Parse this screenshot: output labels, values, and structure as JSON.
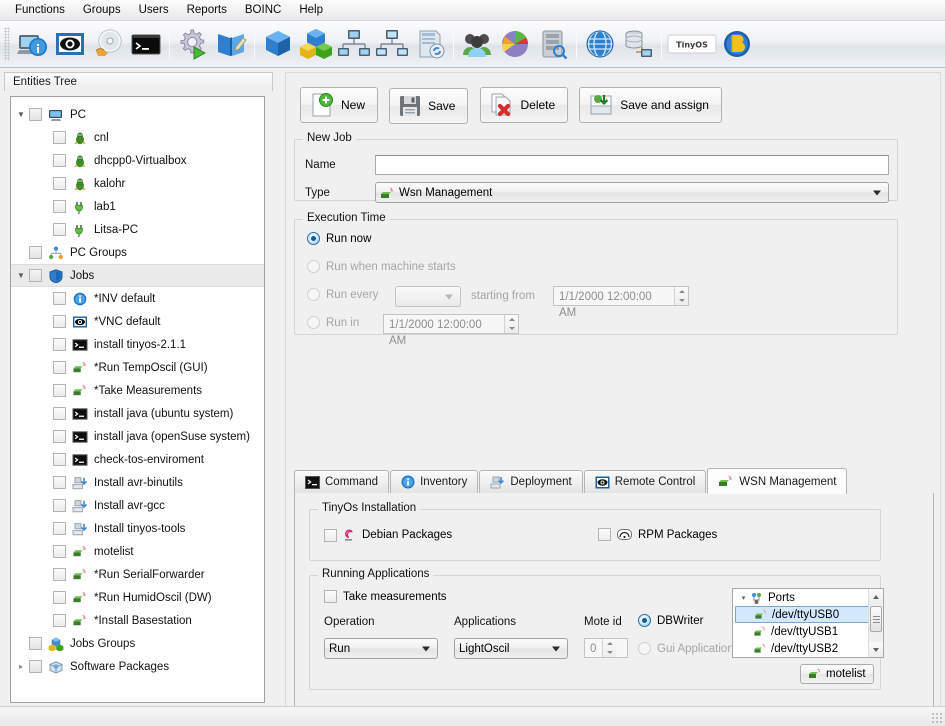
{
  "menu": {
    "items": [
      {
        "label": "Functions",
        "name": "menu-functions"
      },
      {
        "label": "Groups",
        "name": "menu-groups"
      },
      {
        "label": "Users",
        "name": "menu-users"
      },
      {
        "label": "Reports",
        "name": "menu-reports"
      },
      {
        "label": "BOINC",
        "name": "menu-boinc"
      },
      {
        "label": "Help",
        "name": "menu-help"
      }
    ]
  },
  "toolbar": {
    "buttons": [
      {
        "icon": "computer-info-icon",
        "group": 1
      },
      {
        "icon": "eye-monitor-icon",
        "group": 1
      },
      {
        "icon": "disc-hand-icon",
        "group": 1
      },
      {
        "icon": "terminal-console-icon",
        "group": 1
      },
      {
        "icon": "gear-play-icon",
        "group": 2
      },
      {
        "icon": "blue-book-pencil-icon",
        "group": 2
      },
      {
        "icon": "blue-cube-icon",
        "group": 3
      },
      {
        "icon": "cube-group-icon",
        "group": 3
      },
      {
        "icon": "network-computers-icon",
        "group": 3
      },
      {
        "icon": "network-computers-alt-icon",
        "group": 3
      },
      {
        "icon": "book-refresh-icon",
        "group": 3
      },
      {
        "icon": "users-group-icon",
        "group": 4
      },
      {
        "icon": "pie-chart-icon",
        "group": 4
      },
      {
        "icon": "server-search-icon",
        "group": 4
      },
      {
        "icon": "globe-icon",
        "group": 5
      },
      {
        "icon": "database-network-icon",
        "group": 5
      },
      {
        "icon": "tinyos-logo-icon",
        "group": 6
      },
      {
        "icon": "boinc-logo-icon",
        "group": 6
      }
    ]
  },
  "left_pane": {
    "header": "Entities Tree",
    "tree": [
      {
        "label": "PC",
        "level": 1,
        "icon": "monitor-icon",
        "expander": "expanded",
        "checkbox": true,
        "selected": false
      },
      {
        "label": "cnl",
        "level": 2,
        "icon": "linux-tux-icon",
        "expander": "none",
        "checkbox": true,
        "selected": false
      },
      {
        "label": "dhcpp0-Virtualbox",
        "level": 2,
        "icon": "linux-tux-icon",
        "expander": "none",
        "checkbox": true,
        "selected": false
      },
      {
        "label": "kalohr",
        "level": 2,
        "icon": "linux-tux-icon",
        "expander": "none",
        "checkbox": true,
        "selected": false
      },
      {
        "label": "lab1",
        "level": 2,
        "icon": "plug-green-icon",
        "expander": "none",
        "checkbox": true,
        "selected": false
      },
      {
        "label": "Litsa-PC",
        "level": 2,
        "icon": "plug-green-icon",
        "expander": "none",
        "checkbox": true,
        "selected": false
      },
      {
        "label": "PC Groups",
        "level": 1,
        "icon": "network-tree-icon",
        "expander": "none",
        "checkbox": true,
        "selected": false
      },
      {
        "label": "Jobs",
        "level": 1,
        "icon": "shield-blue-icon",
        "expander": "expanded",
        "checkbox": true,
        "selected": true
      },
      {
        "label": "*INV default",
        "level": 2,
        "icon": "info-blue-icon",
        "expander": "none",
        "checkbox": true,
        "selected": false
      },
      {
        "label": "*VNC default",
        "level": 2,
        "icon": "vnc-eye-icon",
        "expander": "none",
        "checkbox": true,
        "selected": false
      },
      {
        "label": "install tinyos-2.1.1",
        "level": 2,
        "icon": "terminal-icon",
        "expander": "none",
        "checkbox": true,
        "selected": false
      },
      {
        "label": "*Run TempOscil (GUI)",
        "level": 2,
        "icon": "mote-sensor-icon",
        "expander": "none",
        "checkbox": true,
        "selected": false
      },
      {
        "label": "*Take Measurements",
        "level": 2,
        "icon": "mote-sensor-icon",
        "expander": "none",
        "checkbox": true,
        "selected": false
      },
      {
        "label": "install java (ubuntu system)",
        "level": 2,
        "icon": "terminal-icon",
        "expander": "none",
        "checkbox": true,
        "selected": false
      },
      {
        "label": "install java (openSuse system)",
        "level": 2,
        "icon": "terminal-icon",
        "expander": "none",
        "checkbox": true,
        "selected": false
      },
      {
        "label": "check-tos-enviroment",
        "level": 2,
        "icon": "terminal-icon",
        "expander": "none",
        "checkbox": true,
        "selected": false
      },
      {
        "label": "Install avr-binutils",
        "level": 2,
        "icon": "package-install-icon",
        "expander": "none",
        "checkbox": true,
        "selected": false
      },
      {
        "label": "Install avr-gcc",
        "level": 2,
        "icon": "package-install-icon",
        "expander": "none",
        "checkbox": true,
        "selected": false
      },
      {
        "label": "Install tinyos-tools",
        "level": 2,
        "icon": "package-install-icon",
        "expander": "none",
        "checkbox": true,
        "selected": false
      },
      {
        "label": "motelist",
        "level": 2,
        "icon": "mote-sensor-icon",
        "expander": "none",
        "checkbox": true,
        "selected": false
      },
      {
        "label": "*Run SerialForwarder",
        "level": 2,
        "icon": "mote-sensor-icon",
        "expander": "none",
        "checkbox": true,
        "selected": false
      },
      {
        "label": "*Run HumidOscil (DW)",
        "level": 2,
        "icon": "mote-sensor-icon",
        "expander": "none",
        "checkbox": true,
        "selected": false
      },
      {
        "label": "*Install Basestation",
        "level": 2,
        "icon": "mote-sensor-icon",
        "expander": "none",
        "checkbox": true,
        "selected": false
      },
      {
        "label": "Jobs Groups",
        "level": 1,
        "icon": "cube-group-icon",
        "expander": "none",
        "checkbox": true,
        "selected": false
      },
      {
        "label": "Software Packages",
        "level": 1,
        "icon": "package-box-icon",
        "expander": "collapsed",
        "checkbox": true,
        "selected": false
      }
    ]
  },
  "actions": {
    "new": "New",
    "save": "Save",
    "delete": "Delete",
    "save_and_assign": "Save and assign"
  },
  "new_job": {
    "legend": "New Job",
    "name_label": "Name",
    "name_value": "",
    "name_placeholder": "",
    "type_label": "Type",
    "type_value": "Wsn Management"
  },
  "execution_time": {
    "legend": "Execution Time",
    "run_now": "Run now",
    "run_when_machine_starts": "Run when machine starts",
    "run_every": "Run every",
    "run_every_value": "",
    "starting_from": "starting from",
    "starting_from_value": "1/1/2000 12:00:00 AM",
    "run_in": "Run in",
    "run_in_value": "1/1/2000 12:00:00 AM",
    "selected": "run_now"
  },
  "tabs": [
    {
      "label": "Command",
      "icon": "terminal-icon",
      "active": false
    },
    {
      "label": "Inventory",
      "icon": "info-blue-icon",
      "active": false
    },
    {
      "label": "Deployment",
      "icon": "package-install-icon",
      "active": false
    },
    {
      "label": "Remote Control",
      "icon": "vnc-eye-icon",
      "active": false
    },
    {
      "label": "WSN Management",
      "icon": "mote-sensor-icon",
      "active": true
    }
  ],
  "wsn_panel": {
    "tinyos_installation": {
      "legend": "TinyOs Installation",
      "debian": "Debian Packages",
      "debian_checked": false,
      "rpm": "RPM Packages",
      "rpm_checked": false
    },
    "running_applications": {
      "legend": "Running Applications",
      "take_measurements": "Take measurements",
      "take_measurements_checked": false,
      "operation_label": "Operation",
      "operation_value": "Run",
      "applications_label": "Applications",
      "applications_value": "LightOscil",
      "mote_id_label": "Mote id",
      "mote_id_value": "0",
      "dbwriter": "DBWriter",
      "gui_application": "Gui Application",
      "output_selected": "dbwriter",
      "ports_title": "Ports",
      "ports": [
        {
          "label": "/dev/ttyUSB0",
          "selected": true
        },
        {
          "label": "/dev/ttyUSB1",
          "selected": false
        },
        {
          "label": "/dev/ttyUSB2",
          "selected": false
        }
      ],
      "motelist_button": "motelist"
    }
  },
  "colors": {
    "selection_blue": "#d3e8fb",
    "accent": "#2b6ea8",
    "window_bg": "#f0f0f0"
  }
}
